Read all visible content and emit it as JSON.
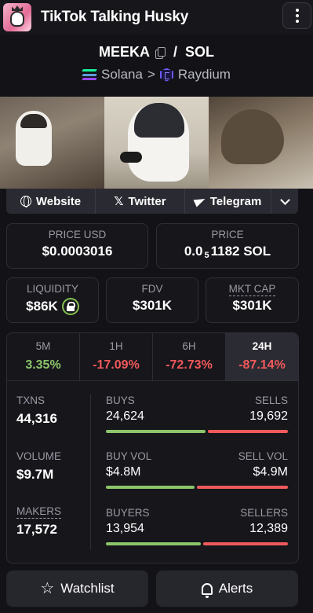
{
  "header": {
    "title": "TikTok Talking Husky"
  },
  "pair": {
    "base": "MEEKA",
    "separator": "/",
    "quote": "SOL",
    "chain": "Solana",
    "arrow": ">",
    "dex": "Raydium"
  },
  "socials": {
    "website": "Website",
    "twitter": "Twitter",
    "telegram": "Telegram"
  },
  "price": {
    "usd_label": "PRICE USD",
    "usd_value": "$0.0003016",
    "sol_label": "PRICE",
    "sol_prefix": "0.0",
    "sol_subscript": "5",
    "sol_digits": "1182 SOL"
  },
  "metrics": {
    "liquidity_label": "LIQUIDITY",
    "liquidity_value": "$86K",
    "fdv_label": "FDV",
    "fdv_value": "$301K",
    "mktcap_label": "MKT CAP",
    "mktcap_value": "$301K"
  },
  "timeframes": [
    {
      "label": "5M",
      "value": "3.35%",
      "trend": "up",
      "active": false
    },
    {
      "label": "1H",
      "value": "-17.09%",
      "trend": "down",
      "active": false
    },
    {
      "label": "6H",
      "value": "-72.73%",
      "trend": "down",
      "active": false
    },
    {
      "label": "24H",
      "value": "-87.14%",
      "trend": "down",
      "active": true
    }
  ],
  "stats": {
    "txns_label": "TXNS",
    "txns_value": "44,316",
    "volume_label": "VOLUME",
    "volume_value": "$9.7M",
    "makers_label": "MAKERS",
    "makers_value": "17,572",
    "buys_label": "BUYS",
    "buys_value": "24,624",
    "sells_label": "SELLS",
    "sells_value": "19,692",
    "buys_fraction": 0.556,
    "buyvol_label": "BUY VOL",
    "buyvol_value": "$4.8M",
    "sellvol_label": "SELL VOL",
    "sellvol_value": "$4.9M",
    "buyvol_fraction": 0.495,
    "buyers_label": "BUYERS",
    "buyers_value": "13,954",
    "sellers_label": "SELLERS",
    "sellers_value": "12,389",
    "buyers_fraction": 0.53
  },
  "actions": {
    "watchlist": "Watchlist",
    "alerts": "Alerts"
  },
  "colors": {
    "green": "#8cc56a",
    "red": "#f0595b",
    "solana_gradient": [
      "#9945ff",
      "#14f195"
    ],
    "raydium": "#6b5bff"
  }
}
